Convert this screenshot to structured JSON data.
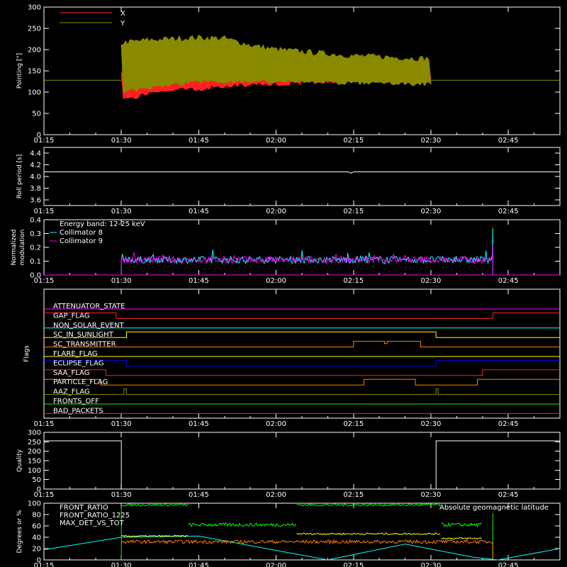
{
  "chart_data": [
    {
      "type": "line",
      "id": "pointing",
      "ylabel": "Pointing [\"]",
      "ylim": [
        0,
        300
      ],
      "yticks": [
        0,
        50,
        100,
        150,
        200,
        250,
        300
      ],
      "xlim": [
        "01:15",
        "02:55"
      ],
      "xticks": [
        "01:15",
        "01:30",
        "01:45",
        "02:00",
        "02:15",
        "02:30",
        "02:45"
      ],
      "series": [
        {
          "name": "X",
          "color": "#ff2020",
          "x": [
            "01:30",
            "01:35",
            "01:40",
            "01:45",
            "01:50",
            "01:55",
            "02:00",
            "02:05",
            "02:10",
            "02:15",
            "02:20",
            "02:25",
            "02:30"
          ],
          "y_low": [
            80,
            95,
            105,
            108,
            115,
            118,
            120,
            122,
            125,
            127,
            127,
            128,
            128
          ],
          "y_high": [
            150,
            158,
            160,
            163,
            165,
            160,
            157,
            158,
            158,
            162,
            165,
            170,
            172
          ]
        },
        {
          "name": "Y",
          "color": "#8a8a00",
          "x": [
            "01:30",
            "01:35",
            "01:40",
            "01:45",
            "01:50",
            "01:55",
            "02:00",
            "02:05",
            "02:10",
            "02:15",
            "02:20",
            "02:25",
            "02:30"
          ],
          "y_low": [
            100,
            110,
            118,
            125,
            125,
            128,
            125,
            125,
            123,
            122,
            120,
            120,
            120
          ],
          "y_high": [
            215,
            222,
            225,
            228,
            226,
            210,
            200,
            195,
            190,
            185,
            183,
            180,
            178
          ]
        }
      ],
      "reference_line": 128
    },
    {
      "type": "line",
      "id": "roll",
      "ylabel": "Roll period [s]",
      "ylim": [
        3.5,
        4.5
      ],
      "yticks": [
        "3.6",
        "3.8",
        "4.0",
        "4.2",
        "4.4"
      ],
      "series": [
        {
          "name": "",
          "color": "#ffffff",
          "x": [
            "01:15",
            "02:55"
          ],
          "y": [
            4.08,
            4.08
          ]
        }
      ]
    },
    {
      "type": "line",
      "id": "modulation",
      "ylabel": "Normalized modulation",
      "ylim": [
        0,
        0.4
      ],
      "yticks": [
        "0.0",
        "0.1",
        "0.2",
        "0.3",
        "0.4"
      ],
      "annotations": [
        "Energy band: 12-25 keV"
      ],
      "series": [
        {
          "name": "Collimator 8",
          "color": "#00ffff",
          "x": [
            "01:30",
            "02:42"
          ],
          "y_mean": 0.11
        },
        {
          "name": "Collimator 9",
          "color": "#ff00ff",
          "x": [
            "01:30",
            "02:42"
          ],
          "y_mean": 0.11
        }
      ]
    },
    {
      "type": "line",
      "id": "flags",
      "ylabel": "Flags",
      "series": [
        {
          "name": "ATTENUATOR_STATE",
          "color": "#ff00ff"
        },
        {
          "name": "GAP_FLAG",
          "color": "#ff2020"
        },
        {
          "name": "NON_SOLAR_EVENT",
          "color": "#00ffff"
        },
        {
          "name": "SC_IN_SUNLIGHT",
          "color": "#ffff00"
        },
        {
          "name": "SC_TRANSMITTER",
          "color": "#ff8000"
        },
        {
          "name": "FLARE_FLAG",
          "color": "#ffff00"
        },
        {
          "name": "ECLIPSE_FLAG",
          "color": "#0000ff"
        },
        {
          "name": "SAA_FLAG",
          "color": "#ff2020"
        },
        {
          "name": "PARTICLE_FLAG",
          "color": "#ff8000"
        },
        {
          "name": "AAZ_FLAG",
          "color": "#8a8a00"
        },
        {
          "name": "FRONTS_OFF",
          "color": "#00ff00"
        },
        {
          "name": "BAD_PACKETS",
          "color": "#ff2020"
        }
      ]
    },
    {
      "type": "line",
      "id": "quality",
      "ylabel": "Quality",
      "ylim": [
        0,
        300
      ],
      "yticks": [
        0,
        50,
        100,
        150,
        200,
        250,
        300
      ],
      "series": [
        {
          "name": "",
          "color": "#ffffff",
          "x": [
            "01:15",
            "01:30",
            "01:30",
            "02:31",
            "02:31",
            "02:55"
          ],
          "y": [
            255,
            255,
            0,
            0,
            255,
            255
          ]
        }
      ]
    },
    {
      "type": "line",
      "id": "ratios",
      "ylabel": "Degrees or %",
      "ylim": [
        0,
        100
      ],
      "yticks": [
        0,
        20,
        40,
        60,
        80,
        100
      ],
      "series": [
        {
          "name": "FRONT_RATIO",
          "color": "#ffff00"
        },
        {
          "name": "FRONT_RATIO_1225",
          "color": "#00ff00"
        },
        {
          "name": "MAX_DET_VS_TOT",
          "color": "#ff8000"
        },
        {
          "name": "Absolute geomagnetic latitude",
          "color": "#00ffff"
        }
      ]
    }
  ]
}
